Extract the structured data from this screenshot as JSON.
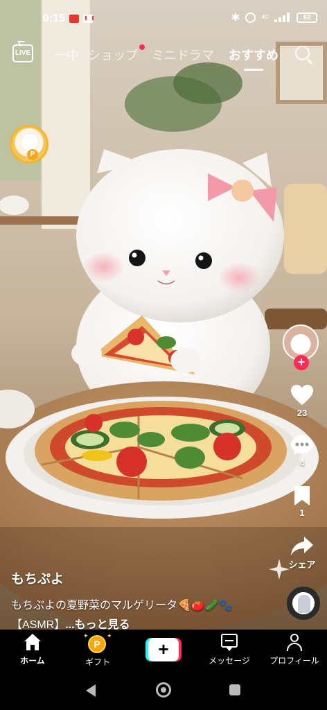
{
  "status_bar": {
    "time": "0:15",
    "network": "4G",
    "battery": "62"
  },
  "top_nav": {
    "live_label": "LIVE",
    "tabs": [
      {
        "label": "一中",
        "active": false
      },
      {
        "label": "ショップ",
        "active": false,
        "has_dot": true
      },
      {
        "label": "ミニドラマ",
        "active": false
      },
      {
        "label": "おすすめ",
        "active": true
      }
    ]
  },
  "actions": {
    "likes": "23",
    "comments": "4",
    "saves": "1",
    "share_label": "シェア"
  },
  "caption": {
    "author": "もちぷよ",
    "description": "もちぷよの夏野菜のマルゲリータ🍕🍅🥒🐾",
    "tag": "【ASMR】",
    "more_label": "...もっと見る"
  },
  "bottom_tabs": {
    "home": "ホーム",
    "gift": "ギフト",
    "create": "+",
    "messages": "メッセージ",
    "profile": "プロフィール"
  },
  "colors": {
    "accent_red": "#fe2c55",
    "accent_cyan": "#25f4ee",
    "coin_gold": "#f6a609"
  },
  "icons": {
    "live": "tv-icon",
    "search": "search-icon",
    "like": "heart-icon",
    "comment": "comment-icon",
    "save": "bookmark-icon",
    "share": "share-arrow-icon",
    "home": "home-icon",
    "gift": "coin-icon",
    "messages": "message-icon",
    "profile": "person-icon"
  }
}
